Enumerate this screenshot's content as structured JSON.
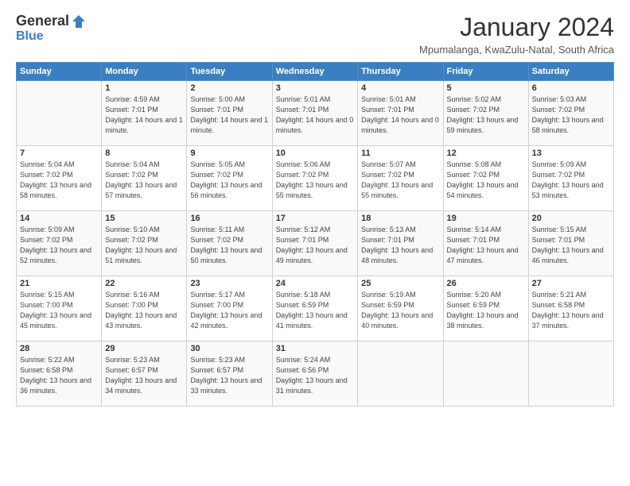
{
  "logo": {
    "general": "General",
    "blue": "Blue"
  },
  "header": {
    "month": "January 2024",
    "location": "Mpumalanga, KwaZulu-Natal, South Africa"
  },
  "weekdays": [
    "Sunday",
    "Monday",
    "Tuesday",
    "Wednesday",
    "Thursday",
    "Friday",
    "Saturday"
  ],
  "weeks": [
    [
      {
        "day": "",
        "sunrise": "",
        "sunset": "",
        "daylight": ""
      },
      {
        "day": "1",
        "sunrise": "Sunrise: 4:59 AM",
        "sunset": "Sunset: 7:01 PM",
        "daylight": "Daylight: 14 hours and 1 minute."
      },
      {
        "day": "2",
        "sunrise": "Sunrise: 5:00 AM",
        "sunset": "Sunset: 7:01 PM",
        "daylight": "Daylight: 14 hours and 1 minute."
      },
      {
        "day": "3",
        "sunrise": "Sunrise: 5:01 AM",
        "sunset": "Sunset: 7:01 PM",
        "daylight": "Daylight: 14 hours and 0 minutes."
      },
      {
        "day": "4",
        "sunrise": "Sunrise: 5:01 AM",
        "sunset": "Sunset: 7:01 PM",
        "daylight": "Daylight: 14 hours and 0 minutes."
      },
      {
        "day": "5",
        "sunrise": "Sunrise: 5:02 AM",
        "sunset": "Sunset: 7:02 PM",
        "daylight": "Daylight: 13 hours and 59 minutes."
      },
      {
        "day": "6",
        "sunrise": "Sunrise: 5:03 AM",
        "sunset": "Sunset: 7:02 PM",
        "daylight": "Daylight: 13 hours and 58 minutes."
      }
    ],
    [
      {
        "day": "7",
        "sunrise": "Sunrise: 5:04 AM",
        "sunset": "Sunset: 7:02 PM",
        "daylight": "Daylight: 13 hours and 58 minutes."
      },
      {
        "day": "8",
        "sunrise": "Sunrise: 5:04 AM",
        "sunset": "Sunset: 7:02 PM",
        "daylight": "Daylight: 13 hours and 57 minutes."
      },
      {
        "day": "9",
        "sunrise": "Sunrise: 5:05 AM",
        "sunset": "Sunset: 7:02 PM",
        "daylight": "Daylight: 13 hours and 56 minutes."
      },
      {
        "day": "10",
        "sunrise": "Sunrise: 5:06 AM",
        "sunset": "Sunset: 7:02 PM",
        "daylight": "Daylight: 13 hours and 55 minutes."
      },
      {
        "day": "11",
        "sunrise": "Sunrise: 5:07 AM",
        "sunset": "Sunset: 7:02 PM",
        "daylight": "Daylight: 13 hours and 55 minutes."
      },
      {
        "day": "12",
        "sunrise": "Sunrise: 5:08 AM",
        "sunset": "Sunset: 7:02 PM",
        "daylight": "Daylight: 13 hours and 54 minutes."
      },
      {
        "day": "13",
        "sunrise": "Sunrise: 5:09 AM",
        "sunset": "Sunset: 7:02 PM",
        "daylight": "Daylight: 13 hours and 53 minutes."
      }
    ],
    [
      {
        "day": "14",
        "sunrise": "Sunrise: 5:09 AM",
        "sunset": "Sunset: 7:02 PM",
        "daylight": "Daylight: 13 hours and 52 minutes."
      },
      {
        "day": "15",
        "sunrise": "Sunrise: 5:10 AM",
        "sunset": "Sunset: 7:02 PM",
        "daylight": "Daylight: 13 hours and 51 minutes."
      },
      {
        "day": "16",
        "sunrise": "Sunrise: 5:11 AM",
        "sunset": "Sunset: 7:02 PM",
        "daylight": "Daylight: 13 hours and 50 minutes."
      },
      {
        "day": "17",
        "sunrise": "Sunrise: 5:12 AM",
        "sunset": "Sunset: 7:01 PM",
        "daylight": "Daylight: 13 hours and 49 minutes."
      },
      {
        "day": "18",
        "sunrise": "Sunrise: 5:13 AM",
        "sunset": "Sunset: 7:01 PM",
        "daylight": "Daylight: 13 hours and 48 minutes."
      },
      {
        "day": "19",
        "sunrise": "Sunrise: 5:14 AM",
        "sunset": "Sunset: 7:01 PM",
        "daylight": "Daylight: 13 hours and 47 minutes."
      },
      {
        "day": "20",
        "sunrise": "Sunrise: 5:15 AM",
        "sunset": "Sunset: 7:01 PM",
        "daylight": "Daylight: 13 hours and 46 minutes."
      }
    ],
    [
      {
        "day": "21",
        "sunrise": "Sunrise: 5:15 AM",
        "sunset": "Sunset: 7:00 PM",
        "daylight": "Daylight: 13 hours and 45 minutes."
      },
      {
        "day": "22",
        "sunrise": "Sunrise: 5:16 AM",
        "sunset": "Sunset: 7:00 PM",
        "daylight": "Daylight: 13 hours and 43 minutes."
      },
      {
        "day": "23",
        "sunrise": "Sunrise: 5:17 AM",
        "sunset": "Sunset: 7:00 PM",
        "daylight": "Daylight: 13 hours and 42 minutes."
      },
      {
        "day": "24",
        "sunrise": "Sunrise: 5:18 AM",
        "sunset": "Sunset: 6:59 PM",
        "daylight": "Daylight: 13 hours and 41 minutes."
      },
      {
        "day": "25",
        "sunrise": "Sunrise: 5:19 AM",
        "sunset": "Sunset: 6:59 PM",
        "daylight": "Daylight: 13 hours and 40 minutes."
      },
      {
        "day": "26",
        "sunrise": "Sunrise: 5:20 AM",
        "sunset": "Sunset: 6:59 PM",
        "daylight": "Daylight: 13 hours and 38 minutes."
      },
      {
        "day": "27",
        "sunrise": "Sunrise: 5:21 AM",
        "sunset": "Sunset: 6:58 PM",
        "daylight": "Daylight: 13 hours and 37 minutes."
      }
    ],
    [
      {
        "day": "28",
        "sunrise": "Sunrise: 5:22 AM",
        "sunset": "Sunset: 6:58 PM",
        "daylight": "Daylight: 13 hours and 36 minutes."
      },
      {
        "day": "29",
        "sunrise": "Sunrise: 5:23 AM",
        "sunset": "Sunset: 6:57 PM",
        "daylight": "Daylight: 13 hours and 34 minutes."
      },
      {
        "day": "30",
        "sunrise": "Sunrise: 5:23 AM",
        "sunset": "Sunset: 6:57 PM",
        "daylight": "Daylight: 13 hours and 33 minutes."
      },
      {
        "day": "31",
        "sunrise": "Sunrise: 5:24 AM",
        "sunset": "Sunset: 6:56 PM",
        "daylight": "Daylight: 13 hours and 31 minutes."
      },
      {
        "day": "",
        "sunrise": "",
        "sunset": "",
        "daylight": ""
      },
      {
        "day": "",
        "sunrise": "",
        "sunset": "",
        "daylight": ""
      },
      {
        "day": "",
        "sunrise": "",
        "sunset": "",
        "daylight": ""
      }
    ]
  ]
}
